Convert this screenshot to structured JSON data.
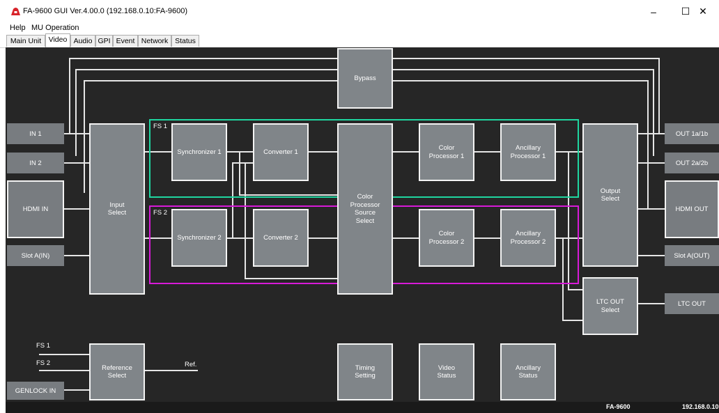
{
  "window": {
    "title": "FA-9600 GUI Ver.4.00.0 (192.168.0.10:FA-9600)",
    "minimize": "–",
    "maximize": "☐",
    "close": "✕"
  },
  "menu": [
    "Help",
    "MU Operation"
  ],
  "tabs": [
    "Main Unit",
    "Video",
    "Audio",
    "GPI",
    "Event",
    "Network",
    "Status"
  ],
  "active_tab": "Video",
  "diagram": {
    "bypass": "Bypass",
    "inputs": {
      "in1": "IN 1",
      "in2": "IN 2",
      "hdmi_in": "HDMI IN",
      "slot_a_in": "Slot A(IN)",
      "genlock_in": "GENLOCK IN"
    },
    "outputs": {
      "out1": "OUT 1a/1b",
      "out2": "OUT 2a/2b",
      "hdmi_out": "HDMI OUT",
      "slot_a_out": "Slot A(OUT)",
      "ltc_out": "LTC OUT"
    },
    "input_select": "Input\nSelect",
    "output_select": "Output\nSelect",
    "ltc_out_select": "LTC OUT\nSelect",
    "fs1_label": "FS 1",
    "fs2_label": "FS 2",
    "synchronizer1": "Synchronizer 1",
    "synchronizer2": "Synchronizer 2",
    "converter1": "Converter 1",
    "converter2": "Converter 2",
    "color_processor_source_select": "Color\nProcessor\nSource\nSelect",
    "color_processor1": "Color\nProcessor 1",
    "color_processor2": "Color\nProcessor 2",
    "ancillary_processor1": "Ancillary\nProcessor 1",
    "ancillary_processor2": "Ancillary\nProcessor 2",
    "ref_fs1": "FS 1",
    "ref_fs2": "FS 2",
    "reference_select": "Reference\nSelect",
    "ref_out": "Ref.",
    "timing_setting": "Timing\nSetting",
    "video_status": "Video\nStatus",
    "ancillary_status": "Ancillary\nStatus",
    "colors": {
      "fs1_frame": "#1fd6a0",
      "fs2_frame": "#d81ad8",
      "block": "#808589",
      "background": "#262626"
    }
  },
  "statusbar": {
    "model": "FA-9600",
    "ip": "192.168.0.10"
  }
}
